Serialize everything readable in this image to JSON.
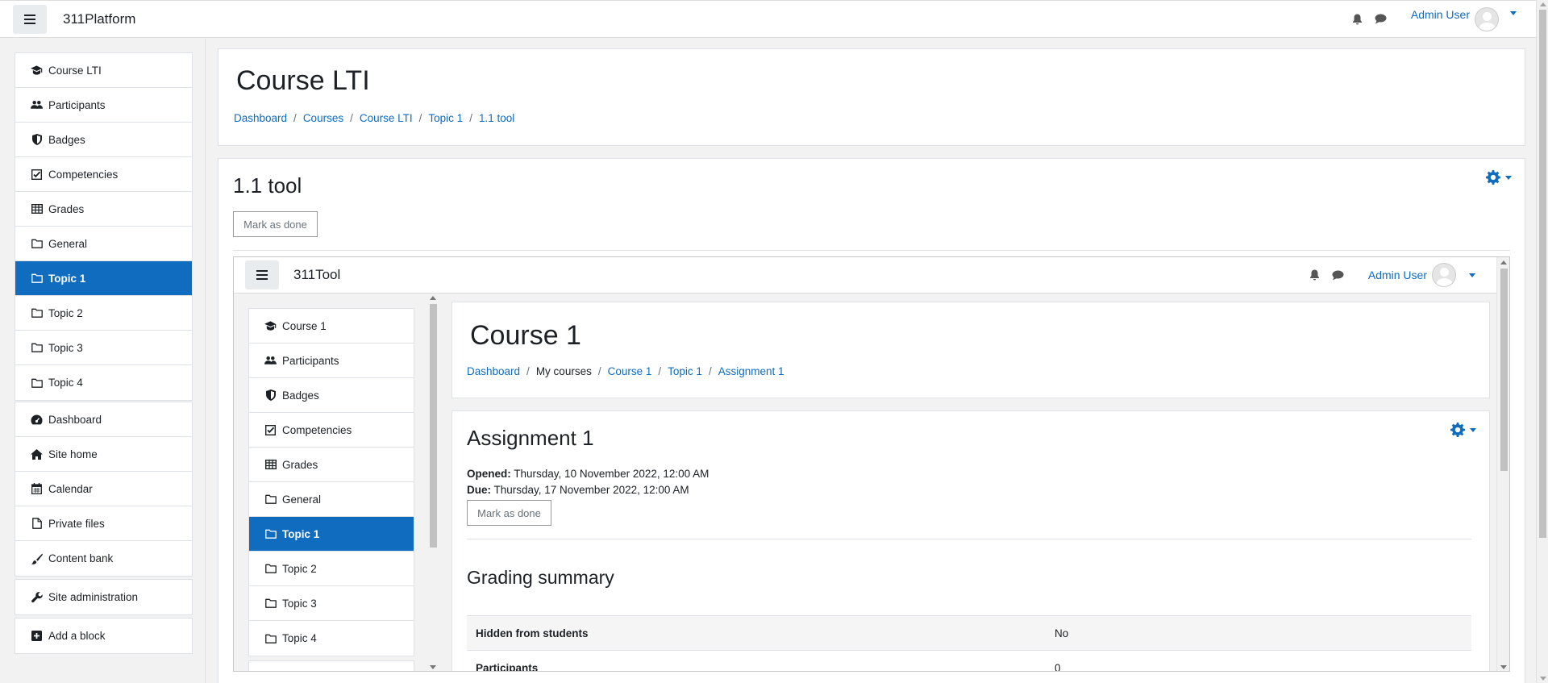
{
  "platform": {
    "brand": "311Platform",
    "user_name": "Admin User"
  },
  "drawer": {
    "course_items": [
      {
        "label": "Course LTI",
        "icon": "graduation-cap-icon"
      },
      {
        "label": "Participants",
        "icon": "users-icon"
      },
      {
        "label": "Badges",
        "icon": "shield-icon"
      },
      {
        "label": "Competencies",
        "icon": "checkbox-icon"
      },
      {
        "label": "Grades",
        "icon": "table-icon"
      },
      {
        "label": "General",
        "icon": "folder-icon"
      },
      {
        "label": "Topic 1",
        "icon": "folder-icon",
        "active": true
      },
      {
        "label": "Topic 2",
        "icon": "folder-icon"
      },
      {
        "label": "Topic 3",
        "icon": "folder-icon"
      },
      {
        "label": "Topic 4",
        "icon": "folder-icon"
      }
    ],
    "site_items": [
      {
        "label": "Dashboard",
        "icon": "dashboard-icon"
      },
      {
        "label": "Site home",
        "icon": "home-icon"
      },
      {
        "label": "Calendar",
        "icon": "calendar-icon"
      },
      {
        "label": "Private files",
        "icon": "file-icon"
      },
      {
        "label": "Content bank",
        "icon": "paintbrush-icon"
      }
    ],
    "admin_item": {
      "label": "Site administration",
      "icon": "wrench-icon"
    },
    "add_block": {
      "label": "Add a block",
      "icon": "plus-square-icon"
    }
  },
  "header": {
    "title": "Course LTI",
    "breadcrumbs": [
      "Dashboard",
      "Courses",
      "Course LTI",
      "Topic 1",
      "1.1 tool"
    ]
  },
  "activity": {
    "title": "1.1 tool",
    "mark_done_label": "Mark as done"
  },
  "tool": {
    "brand": "311Tool",
    "user_name": "Admin User",
    "drawer_items": [
      {
        "label": "Course 1",
        "icon": "graduation-cap-icon"
      },
      {
        "label": "Participants",
        "icon": "users-icon"
      },
      {
        "label": "Badges",
        "icon": "shield-icon"
      },
      {
        "label": "Competencies",
        "icon": "checkbox-icon"
      },
      {
        "label": "Grades",
        "icon": "table-icon"
      },
      {
        "label": "General",
        "icon": "folder-icon"
      },
      {
        "label": "Topic 1",
        "icon": "folder-icon",
        "active": true
      },
      {
        "label": "Topic 2",
        "icon": "folder-icon"
      },
      {
        "label": "Topic 3",
        "icon": "folder-icon"
      },
      {
        "label": "Topic 4",
        "icon": "folder-icon"
      }
    ],
    "header": {
      "title": "Course 1",
      "breadcrumbs": [
        "Dashboard",
        "My courses",
        "Course 1",
        "Topic 1",
        "Assignment 1"
      ]
    },
    "assignment": {
      "title": "Assignment 1",
      "opened_label": "Opened:",
      "opened_value": "Thursday, 10 November 2022, 12:00 AM",
      "due_label": "Due:",
      "due_value": "Thursday, 17 November 2022, 12:00 AM",
      "mark_done_label": "Mark as done",
      "grading_title": "Grading summary",
      "grading_rows": [
        {
          "key": "Hidden from students",
          "value": "No"
        },
        {
          "key": "Participants",
          "value": "0"
        }
      ]
    }
  },
  "colors": {
    "accent": "#0f6cbf",
    "text": "#1d2125",
    "background": "#f2f2f2"
  }
}
